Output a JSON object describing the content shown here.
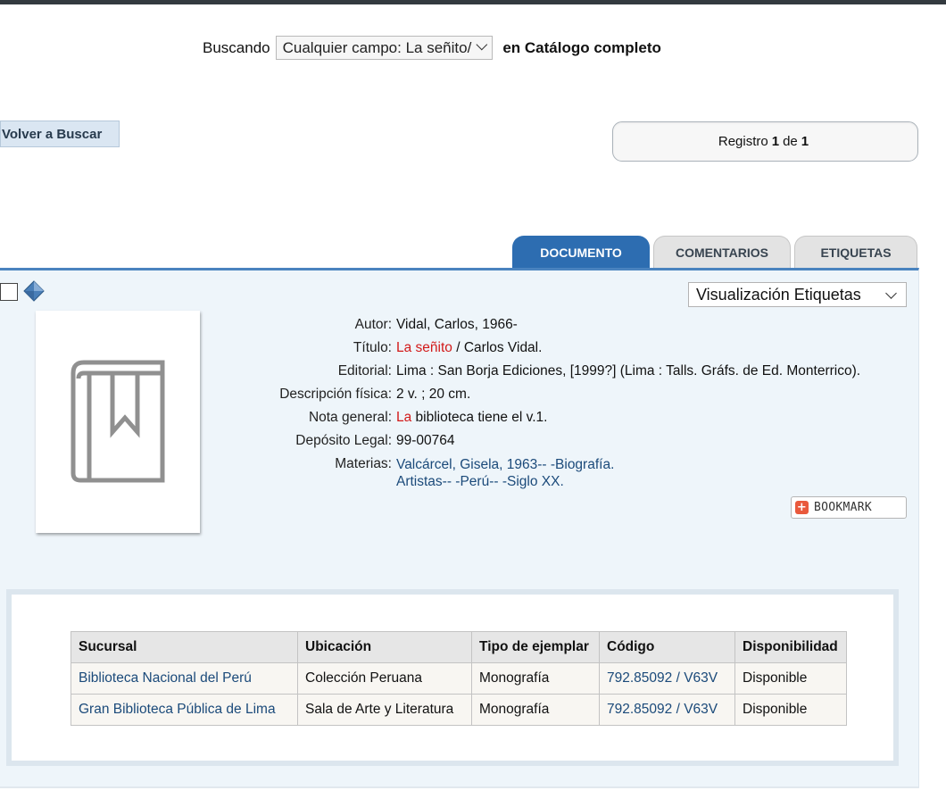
{
  "search": {
    "label": "Buscando",
    "query": "Cualquier campo: La señito/",
    "scope": "en Catálogo completo"
  },
  "nav": {
    "back_label": "Volver a Buscar",
    "record_label": "Registro",
    "record_index": "1",
    "record_of": "de",
    "record_total": "1"
  },
  "tabs": [
    {
      "label": "DOCUMENTO",
      "active": true
    },
    {
      "label": "COMENTARIOS",
      "active": false
    },
    {
      "label": "ETIQUETAS",
      "active": false
    }
  ],
  "view_select": "Visualización Etiquetas",
  "record": {
    "autor_k": "Autor:",
    "autor_v": "Vidal, Carlos, 1966-",
    "titulo_k": "Título:",
    "titulo_hl": "La señito",
    "titulo_rest": " / Carlos Vidal.",
    "editorial_k": "Editorial:",
    "editorial_v": "Lima : San Borja Ediciones, [1999?] (Lima : Talls. Gráfs. de Ed. Monterrico).",
    "descripcion_k": "Descripción física:",
    "descripcion_v": "2 v. ; 20 cm.",
    "nota_k": "Nota general:",
    "nota_hl": "La",
    "nota_rest": " biblioteca tiene el v.1.",
    "deposito_k": "Depósito Legal:",
    "deposito_v": "99-00764",
    "materias_k": "Materias:",
    "materias_1": "Valcárcel, Gisela, 1963-- -Biografía.",
    "materias_2": "Artistas-- -Perú-- -Siglo XX."
  },
  "bookmark_label": "BOOKMARK",
  "holdings": {
    "headers": [
      "Sucursal",
      "Ubicación",
      "Tipo de ejemplar",
      "Código",
      "Disponibilidad"
    ],
    "rows": [
      {
        "sucursal": "Biblioteca Nacional del Perú",
        "ubicacion": "Colección Peruana",
        "tipo": "Monografía",
        "codigo": "792.85092 / V63V",
        "disponibilidad": "Disponible"
      },
      {
        "sucursal": "Gran Biblioteca Pública de Lima",
        "ubicacion": "Sala de Arte y Literatura",
        "tipo": "Monografía",
        "codigo": "792.85092 / V63V",
        "disponibilidad": "Disponible"
      }
    ]
  },
  "colors": {
    "tab_active": "#2d6db1",
    "panel_bg": "#eef5fa",
    "link": "#1b4a7a",
    "highlight": "#d21a1a"
  },
  "icons": [
    "checkbox-icon",
    "gem-icon",
    "book-cover-icon",
    "bookmark-plus-icon",
    "chevron-down-icon"
  ]
}
